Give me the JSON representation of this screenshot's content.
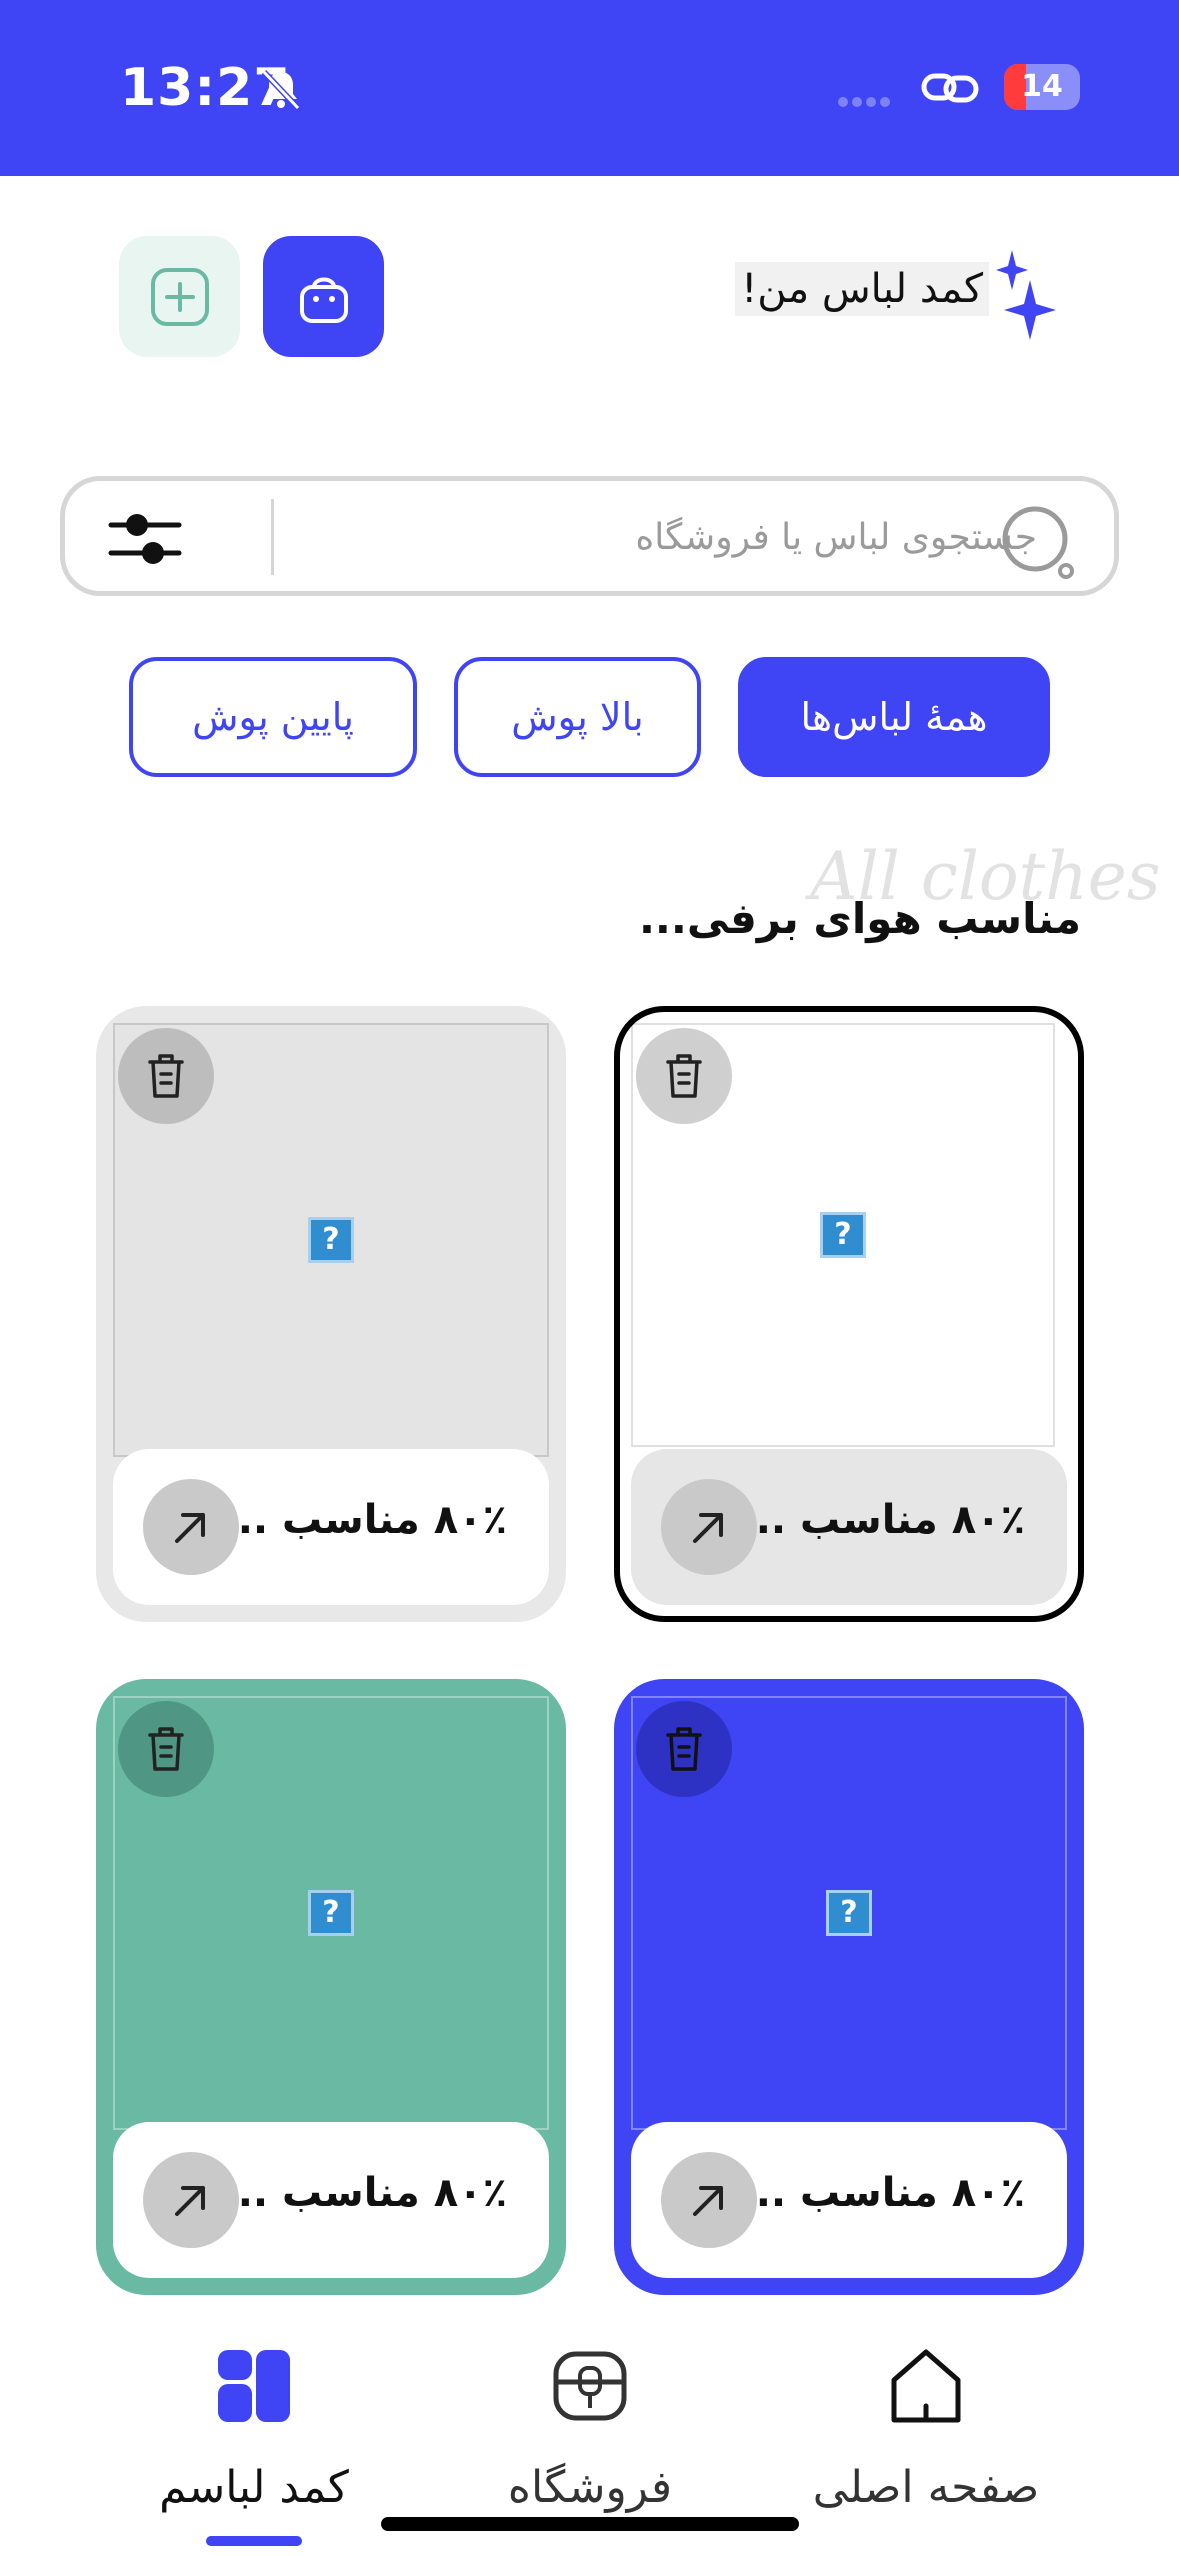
{
  "status_bar": {
    "time": "13:27",
    "battery": "14"
  },
  "header": {
    "title": "کمد لباس من!"
  },
  "search": {
    "placeholder": "جستجوی لباس یا فروشگاه"
  },
  "filters": [
    {
      "label": "همهٔ لباس‌ها",
      "active": true
    },
    {
      "label": "بالا پوش",
      "active": false
    },
    {
      "label": "پایین پوش",
      "active": false
    }
  ],
  "section": {
    "title": "مناسب هوای برفی...",
    "watermark": "All clothes"
  },
  "cards": [
    {
      "match_text": "۸۰٪ مناسب ...",
      "theme": "outlined",
      "bg": "#ffffff",
      "footer_bg": "#e6e6e6"
    },
    {
      "match_text": "۸۰٪ مناسب ...",
      "theme": "gray",
      "bg": "#e8e8e8",
      "footer_bg": "#ffffff"
    },
    {
      "match_text": "۸۰٪ مناسب ...",
      "theme": "blue",
      "bg": "#3f44f5",
      "footer_bg": "#ffffff"
    },
    {
      "match_text": "۸۰٪ مناسب ...",
      "theme": "green",
      "bg": "#69b9a3",
      "footer_bg": "#ffffff"
    }
  ],
  "nav": [
    {
      "label": "صفحه اصلی",
      "icon": "home-icon",
      "active": false
    },
    {
      "label": "فروشگاه",
      "icon": "store-icon",
      "active": false
    },
    {
      "label": "کمد لباسم",
      "icon": "grid-icon",
      "active": true
    }
  ],
  "colors": {
    "primary": "#3f44f5",
    "green": "#69b9a3",
    "light_green": "#e8f5f1",
    "gray": "#e8e8e8"
  }
}
